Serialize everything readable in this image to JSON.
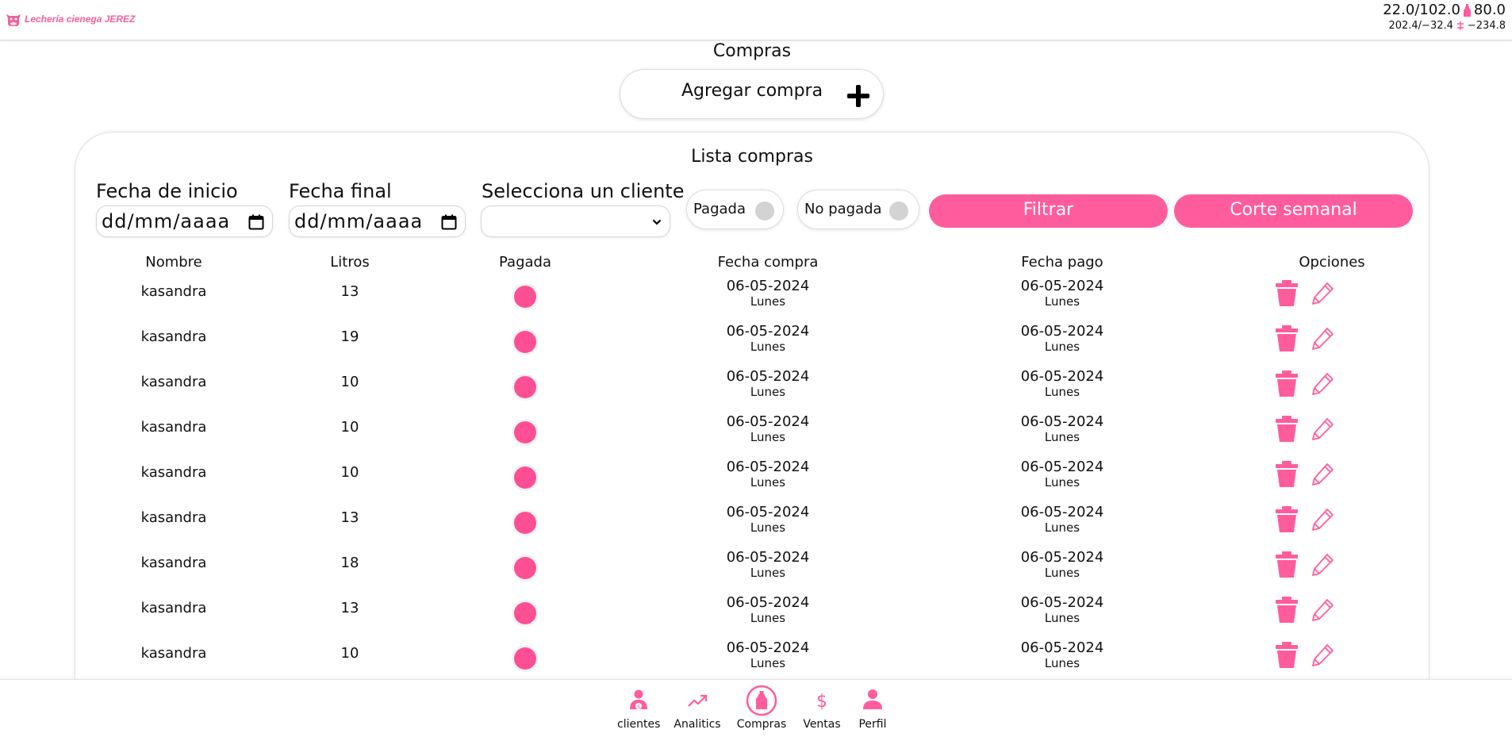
{
  "brand": {
    "name": "Lechería cienega JEREZ",
    "accent": "#ff5c9e"
  },
  "header_stats": {
    "line1_prefix": "22.0/102.0",
    "line1_value": "80.0",
    "line2_prefix": "202.4/−32.4",
    "line2_value": "−234.8"
  },
  "page": {
    "title": "Compras",
    "add_button_label": "Agregar compra"
  },
  "list": {
    "title": "Lista compras",
    "filters": {
      "start_label": "Fecha de inicio",
      "start_value": "dd/mm/aaaa",
      "end_label": "Fecha final",
      "end_value": "dd/mm/aaaa",
      "client_label": "Selecciona un cliente",
      "client_value": "",
      "paid_label": "Pagada",
      "unpaid_label": "No pagada",
      "filter_button": "Filtrar",
      "weekly_button": "Corte semanal"
    },
    "columns": [
      "Nombre",
      "Litros",
      "Pagada",
      "Fecha compra",
      "Fecha pago",
      "Opciones"
    ],
    "rows": [
      {
        "nombre": "kasandra",
        "litros": "13",
        "fecha_compra": "06-05-2024",
        "dia_compra": "Lunes",
        "fecha_pago": "06-05-2024",
        "dia_pago": "Lunes"
      },
      {
        "nombre": "kasandra",
        "litros": "19",
        "fecha_compra": "06-05-2024",
        "dia_compra": "Lunes",
        "fecha_pago": "06-05-2024",
        "dia_pago": "Lunes"
      },
      {
        "nombre": "kasandra",
        "litros": "10",
        "fecha_compra": "06-05-2024",
        "dia_compra": "Lunes",
        "fecha_pago": "06-05-2024",
        "dia_pago": "Lunes"
      },
      {
        "nombre": "kasandra",
        "litros": "10",
        "fecha_compra": "06-05-2024",
        "dia_compra": "Lunes",
        "fecha_pago": "06-05-2024",
        "dia_pago": "Lunes"
      },
      {
        "nombre": "kasandra",
        "litros": "10",
        "fecha_compra": "06-05-2024",
        "dia_compra": "Lunes",
        "fecha_pago": "06-05-2024",
        "dia_pago": "Lunes"
      },
      {
        "nombre": "kasandra",
        "litros": "13",
        "fecha_compra": "06-05-2024",
        "dia_compra": "Lunes",
        "fecha_pago": "06-05-2024",
        "dia_pago": "Lunes"
      },
      {
        "nombre": "kasandra",
        "litros": "18",
        "fecha_compra": "06-05-2024",
        "dia_compra": "Lunes",
        "fecha_pago": "06-05-2024",
        "dia_pago": "Lunes"
      },
      {
        "nombre": "kasandra",
        "litros": "13",
        "fecha_compra": "06-05-2024",
        "dia_compra": "Lunes",
        "fecha_pago": "06-05-2024",
        "dia_pago": "Lunes"
      },
      {
        "nombre": "kasandra",
        "litros": "10",
        "fecha_compra": "06-05-2024",
        "dia_compra": "Lunes",
        "fecha_pago": "06-05-2024",
        "dia_pago": "Lunes"
      }
    ]
  },
  "nav": [
    {
      "label": "clientes",
      "icon": "client-icon"
    },
    {
      "label": "Analitics",
      "icon": "trend-icon"
    },
    {
      "label": "Compras",
      "icon": "bottle-icon",
      "active": true
    },
    {
      "label": "Ventas",
      "icon": "dollar-icon"
    },
    {
      "label": "Perfil",
      "icon": "person-icon"
    }
  ]
}
